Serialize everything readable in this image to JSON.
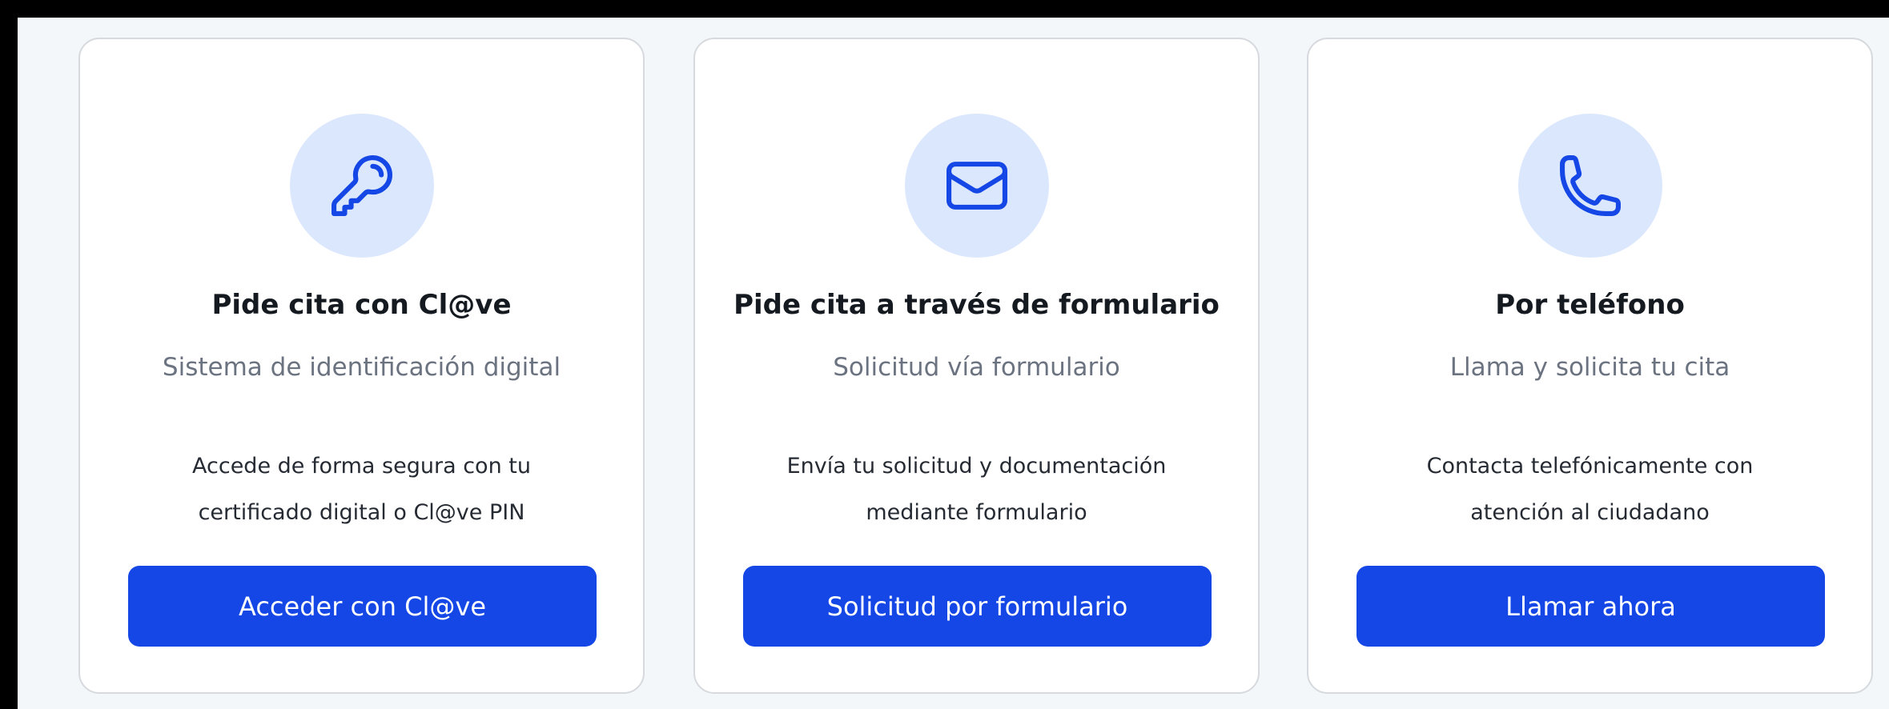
{
  "colors": {
    "background_outer": "#000000",
    "background_panel": "#f4f7f9",
    "card_background": "#ffffff",
    "card_border": "#d6d9dd",
    "icon_circle": "#dbe7fd",
    "icon_stroke": "#1447e6",
    "button_primary": "#1447e6",
    "button_text": "#ffffff",
    "title_text": "#151a21",
    "subtitle_text": "#6b7280",
    "description_text": "#262b33"
  },
  "cards": [
    {
      "icon": "key-icon",
      "title": "Pide cita con Cl@ve",
      "subtitle": "Sistema de identificación digital",
      "description_line_1": "Accede de forma segura con tu",
      "description_line_2": "certificado digital o Cl@ve PIN",
      "button_label": "Acceder con Cl@ve"
    },
    {
      "icon": "mail-icon",
      "title": "Pide cita a través de formulario",
      "subtitle": "Solicitud vía formulario",
      "description_line_1": "Envía tu solicitud y documentación",
      "description_line_2": "mediante formulario",
      "button_label": "Solicitud por formulario"
    },
    {
      "icon": "phone-icon",
      "title": "Por teléfono",
      "subtitle": "Llama y solicita tu cita",
      "description_line_1": "Contacta telefónicamente con",
      "description_line_2": "atención al ciudadano",
      "button_label": "Llamar ahora"
    }
  ]
}
